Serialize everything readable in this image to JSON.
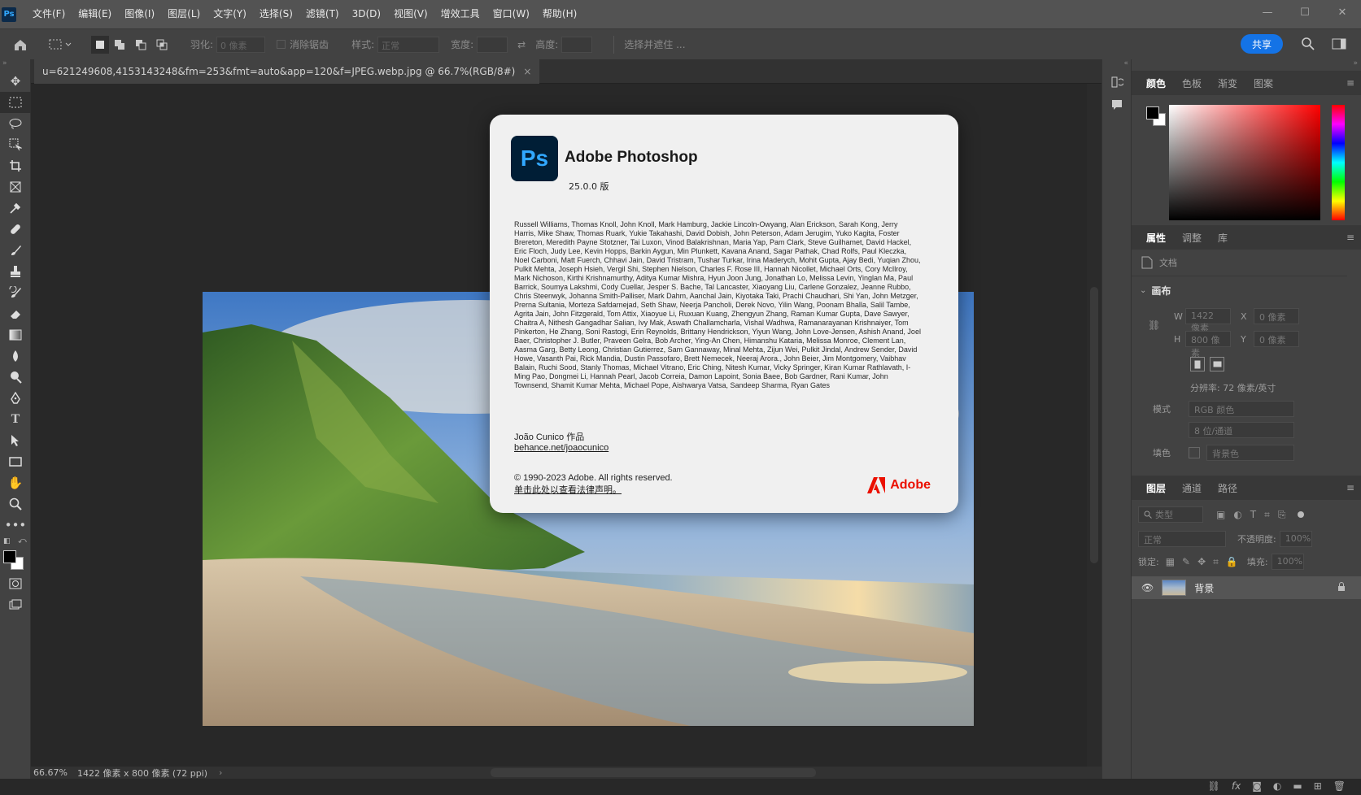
{
  "menubar": {
    "logo": "Ps",
    "items": [
      "文件(F)",
      "编辑(E)",
      "图像(I)",
      "图层(L)",
      "文字(Y)",
      "选择(S)",
      "滤镜(T)",
      "3D(D)",
      "视图(V)",
      "增效工具",
      "窗口(W)",
      "帮助(H)"
    ]
  },
  "options": {
    "feather_label": "羽化:",
    "feather_value": "0 像素",
    "antialias_label": "消除锯齿",
    "style_label": "样式:",
    "style_value": "正常",
    "width_label": "宽度:",
    "height_label": "高度:",
    "select_mask": "选择并遮住 ...",
    "share": "共享"
  },
  "document": {
    "tab_title": "u=621249608,4153143248&fm=253&fmt=auto&app=120&f=JPEG.webp.jpg @ 66.7%(RGB/8#)",
    "close": "×"
  },
  "status": {
    "zoom": "66.67%",
    "info": "1422 像素 x 800 像素 (72 ppi)"
  },
  "about": {
    "logo": "Ps",
    "product": "Adobe Photoshop",
    "version": "25.0.0 版",
    "credits": "Russell Williams, Thomas Knoll, John Knoll, Mark Hamburg, Jackie Lincoln-Owyang, Alan Erickson, Sarah Kong, Jerry Harris, Mike Shaw, Thomas Ruark, Yukie Takahashi, David Dobish, John Peterson, Adam Jerugim, Yuko Kagita, Foster Brereton, Meredith Payne Stotzner, Tai Luxon, Vinod Balakrishnan, Maria Yap, Pam Clark, Steve Guilhamet, David Hackel, Eric Floch, Judy Lee, Kevin Hopps, Barkin Aygun, Min Plunkett, Kavana Anand, Sagar Pathak, Chad Rolfs, Paul Kleczka, Noel Carboni, Matt Fuerch, Chhavi Jain, David Tristram, Tushar Turkar, Irina Maderych, Mohit Gupta, Ajay Bedi, Yuqian Zhou, Pulkit Mehta, Joseph Hsieh, Vergil Shi, Stephen Nielson, Charles F. Rose III, Hannah Nicollet, Michael Orts, Cory McIlroy, Mark Nichoson, Kirthi Krishnamurthy, Aditya Kumar Mishra, Hyun Joon Jung, Jonathan Lo, Melissa Levin, Yinglan Ma, Paul Barrick, Soumya Lakshmi, Cody Cuellar, Jesper S. Bache, Tal Lancaster, Xiaoyang Liu, Carlene Gonzalez, Jeanne Rubbo, Chris Steenwyk, Johanna Smith-Palliser, Mark Dahm, Aanchal Jain, Kiyotaka Taki, Prachi Chaudhari, Shi Yan, John Metzger, Prerna Sultania, Morteza Safdarnejad, Seth Shaw, Neerja Pancholi, Derek Novo, Yilin Wang, Poonam Bhalla, Salil Tambe, Agrita Jain, John Fitzgerald, Tom Attix, Xiaoyue Li, Ruxuan Kuang, Zhengyun Zhang, Raman Kumar Gupta, Dave Sawyer, Chaitra A, Nithesh Gangadhar Salian, Ivy Mak, Aswath Challamcharla, Vishal Wadhwa, Ramanarayanan Krishnaiyer, Tom Pinkerton, He Zhang, Soni Rastogi, Erin Reynolds, Brittany Hendrickson, Yiyun Wang, John Love-Jensen, Ashish Anand, Joel Baer, Christopher J. Butler, Praveen Gelra, Bob Archer, Ying-An Chen, Himanshu Kataria, Melissa Monroe, Clement Lan, Aasma Garg, Betty Leong, Christian Gutierrez, Sam Gannaway, Minal Mehta, Zijun Wei, Pulkit Jindal, Andrew Sender, David Howe, Vasanth Pai, Rick Mandia, Dustin Passofaro, Brett Nemecek, Neeraj Arora., John Beier, Jim Montgomery, Vaibhav Balain, Ruchi Sood, Stanly Thomas, Michael Vitrano, Eric Ching, Nitesh Kumar, Vicky Springer, Kiran Kumar Rathlavath, I-Ming Pao, Dongmei Li, Hannah Pearl, Jacob Correia, Damon Lapoint, Sonia Baee, Bob Gardner, Rani Kumar, John Townsend, Shamit Kumar Mehta, Michael Pope, Aishwarya Vatsa, Sandeep Sharma, Ryan Gates",
    "artist": "João Cunico 作品",
    "artist_link": "behance.net/joaocunico",
    "copyright": "© 1990-2023 Adobe. All rights reserved.",
    "legal_link": "单击此处以查看法律声明。",
    "adobe_word": "Adobe"
  },
  "color_panel": {
    "tabs": [
      "颜色",
      "色板",
      "渐变",
      "图案"
    ]
  },
  "properties": {
    "tabs": [
      "属性",
      "调整",
      "库"
    ],
    "doc_label": "文档",
    "canvas_section": "画布",
    "w_label": "W",
    "w_value": "1422 像素",
    "x_label": "X",
    "x_value": "0 像素",
    "h_label": "H",
    "h_value": "800 像素",
    "y_label": "Y",
    "y_value": "0 像素",
    "resolution": "分辨率: 72 像素/英寸",
    "mode_label": "模式",
    "mode_value": "RGB 颜色",
    "depth_value": "8 位/通道",
    "fill_label": "填色",
    "fill_value": "背景色"
  },
  "layers": {
    "tabs": [
      "图层",
      "通道",
      "路径"
    ],
    "filter_placeholder": "类型",
    "blend_mode": "正常",
    "opacity_label": "不透明度:",
    "opacity_value": "100%",
    "lock_label": "锁定:",
    "fill_label": "填充:",
    "fill_value": "100%",
    "layer_name": "背景"
  },
  "colors": {
    "accent": "#1473e6",
    "adobe_red": "#eb1000",
    "ps_blue": "#31a8ff"
  }
}
